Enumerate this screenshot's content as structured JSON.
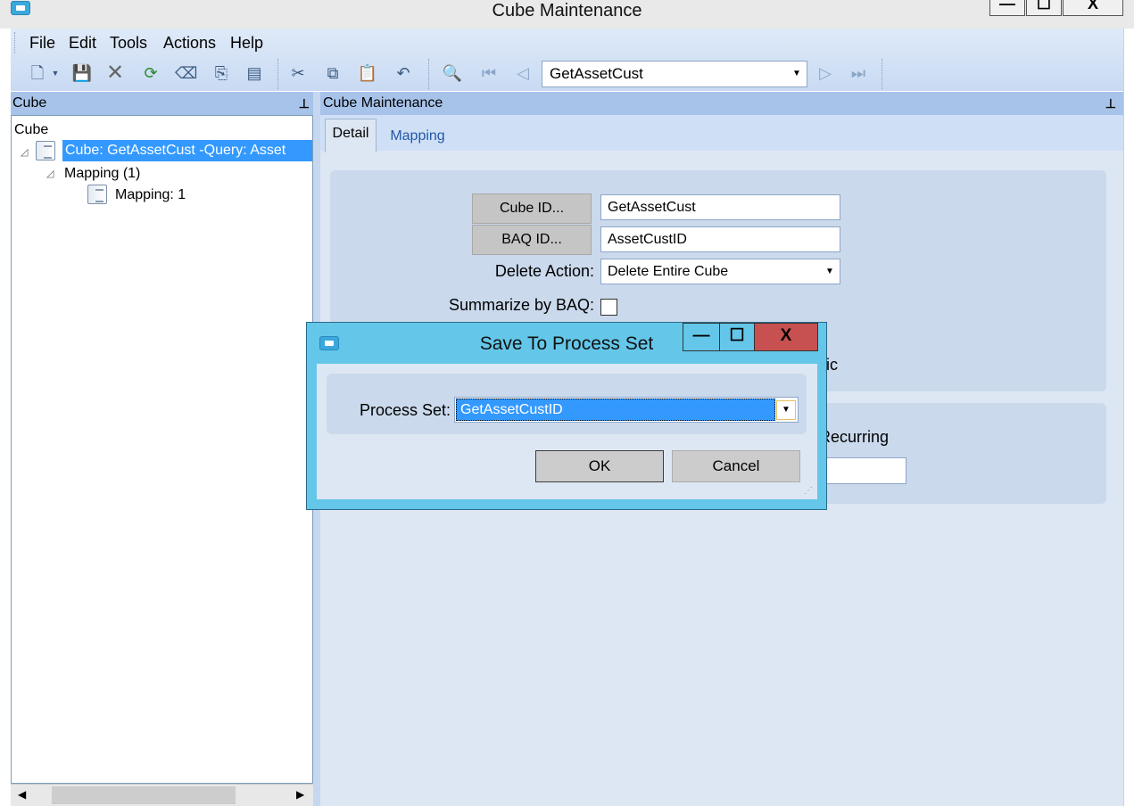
{
  "window": {
    "title": "Cube Maintenance",
    "minimize_glyph": "—",
    "maximize_glyph": "☐",
    "close_glyph": "X"
  },
  "menu": [
    "File",
    "Edit",
    "Tools",
    "Actions",
    "Help"
  ],
  "toolbar": {
    "icons": [
      "new-icon",
      "save-icon",
      "delete-icon",
      "refresh-icon",
      "clear-icon",
      "attach-icon",
      "export-icon",
      "cut-icon",
      "copy-icon",
      "paste-icon",
      "undo-icon",
      "search-icon",
      "first-record-icon",
      "previous-record-icon",
      "next-record-icon",
      "last-record-icon"
    ],
    "nav_value": "GetAssetCust"
  },
  "left_pane": {
    "header": "Cube",
    "pin_glyph": "⊥",
    "tree": {
      "root": "Cube",
      "cube_node": "Cube:  GetAssetCust -Query: Asset",
      "mapping_group": "Mapping (1)",
      "mapping_node": "Mapping: 1"
    }
  },
  "right_pane": {
    "header": "Cube Maintenance",
    "tabs": [
      "Detail",
      "Mapping"
    ],
    "cube_id_label": "Cube ID...",
    "cube_id_value": "GetAssetCust",
    "baq_id_label": "BAQ ID...",
    "baq_id_value": "AssetCustID",
    "delete_action_label": "Delete Action:",
    "delete_action_value": "Delete Entire Cube",
    "summarize_label": "Summarize by BAQ:",
    "summarize_checked": false,
    "partial_text_1": "ic",
    "partial_text_2": "Recurring"
  },
  "dialog": {
    "title": "Save To Process Set",
    "process_set_label": "Process Set:",
    "process_set_value": "GetAssetCustID",
    "ok_label": "OK",
    "cancel_label": "Cancel"
  },
  "colors": {
    "accent": "#3399ff",
    "dialog_frame": "#64c7e9",
    "close_red": "#c75050",
    "pane_header": "#a7c3e9"
  }
}
